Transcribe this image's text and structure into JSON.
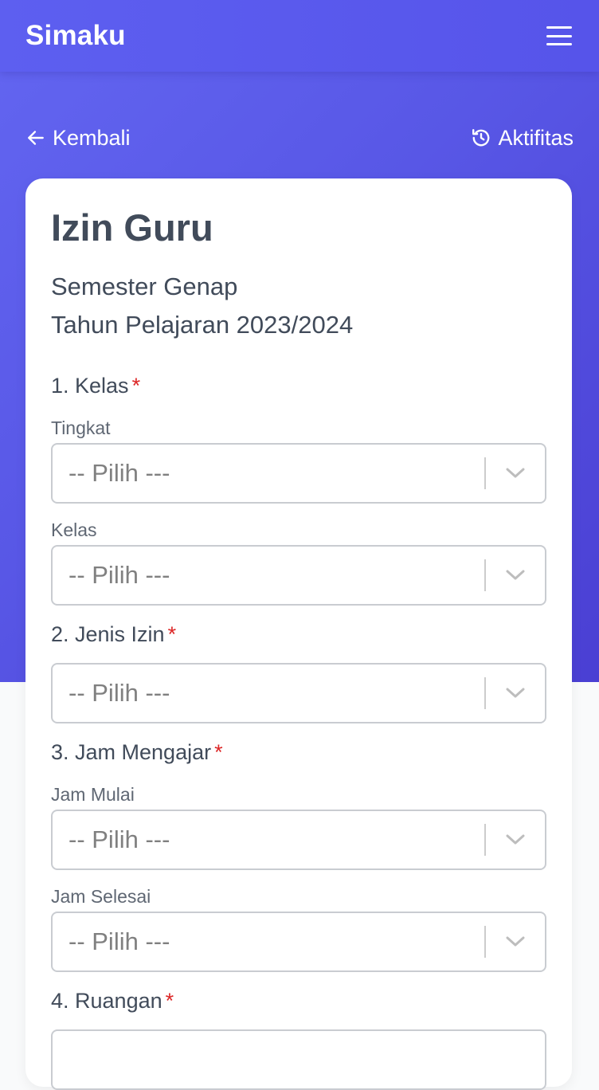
{
  "app": {
    "brand": "Simaku"
  },
  "nav": {
    "back_label": "Kembali",
    "activity_label": "Aktifitas"
  },
  "form": {
    "title": "Izin Guru",
    "semester": "Semester Genap",
    "academic_year": "Tahun Pelajaran 2023/2024",
    "required_mark": "*",
    "sections": {
      "kelas": {
        "label": "1. Kelas",
        "tingkat_label": "Tingkat",
        "tingkat_value": "-- Pilih ---",
        "kelas_label": "Kelas",
        "kelas_value": "-- Pilih ---"
      },
      "jenis_izin": {
        "label": "2. Jenis Izin",
        "value": "-- Pilih ---"
      },
      "jam_mengajar": {
        "label": "3. Jam Mengajar",
        "mulai_label": "Jam Mulai",
        "mulai_value": "-- Pilih ---",
        "selesai_label": "Jam Selesai",
        "selesai_value": "-- Pilih ---"
      },
      "ruangan": {
        "label": "4. Ruangan",
        "value": ""
      }
    }
  },
  "colors": {
    "primary": "#5d5ff0",
    "required": "#dc2626",
    "text": "#414b5a"
  },
  "icons": {
    "menu": "hamburger-icon",
    "back": "arrow-left-icon",
    "activity": "history-icon",
    "dropdown": "chevron-down-icon"
  }
}
